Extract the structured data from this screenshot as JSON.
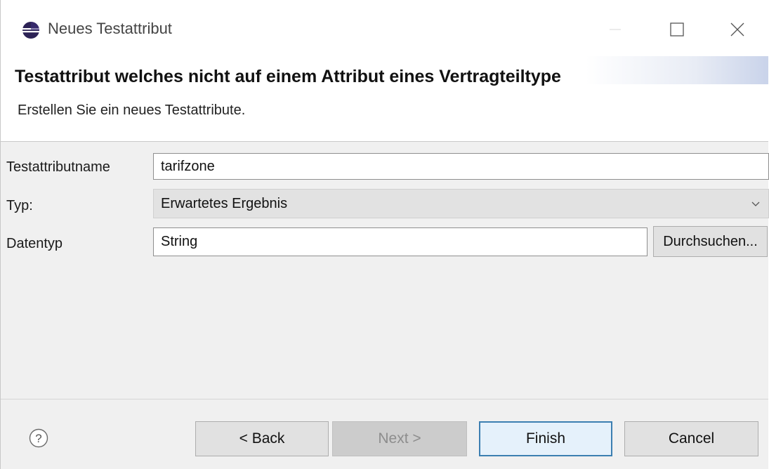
{
  "window": {
    "title": "Neues Testattribut",
    "icon": "eclipse-icon"
  },
  "header": {
    "title": "Testattribut welches nicht auf einem Attribut eines Vertragteiltype",
    "description": "Erstellen Sie ein neues Testattribute."
  },
  "form": {
    "name_label": "Testattributname",
    "name_value": "tarifzone",
    "type_label": "Typ:",
    "type_value": "Erwartetes Ergebnis",
    "datatype_label": "Datentyp",
    "datatype_value": "String",
    "browse_label": "Durchsuchen..."
  },
  "footer": {
    "help_icon": "help-icon",
    "back_label": "< Back",
    "next_label": "Next >",
    "finish_label": "Finish",
    "cancel_label": "Cancel"
  },
  "colors": {
    "default_button_border": "#3c7fb1",
    "panel_background": "#f0f0f0",
    "disabled_text": "#8d8d8d"
  }
}
